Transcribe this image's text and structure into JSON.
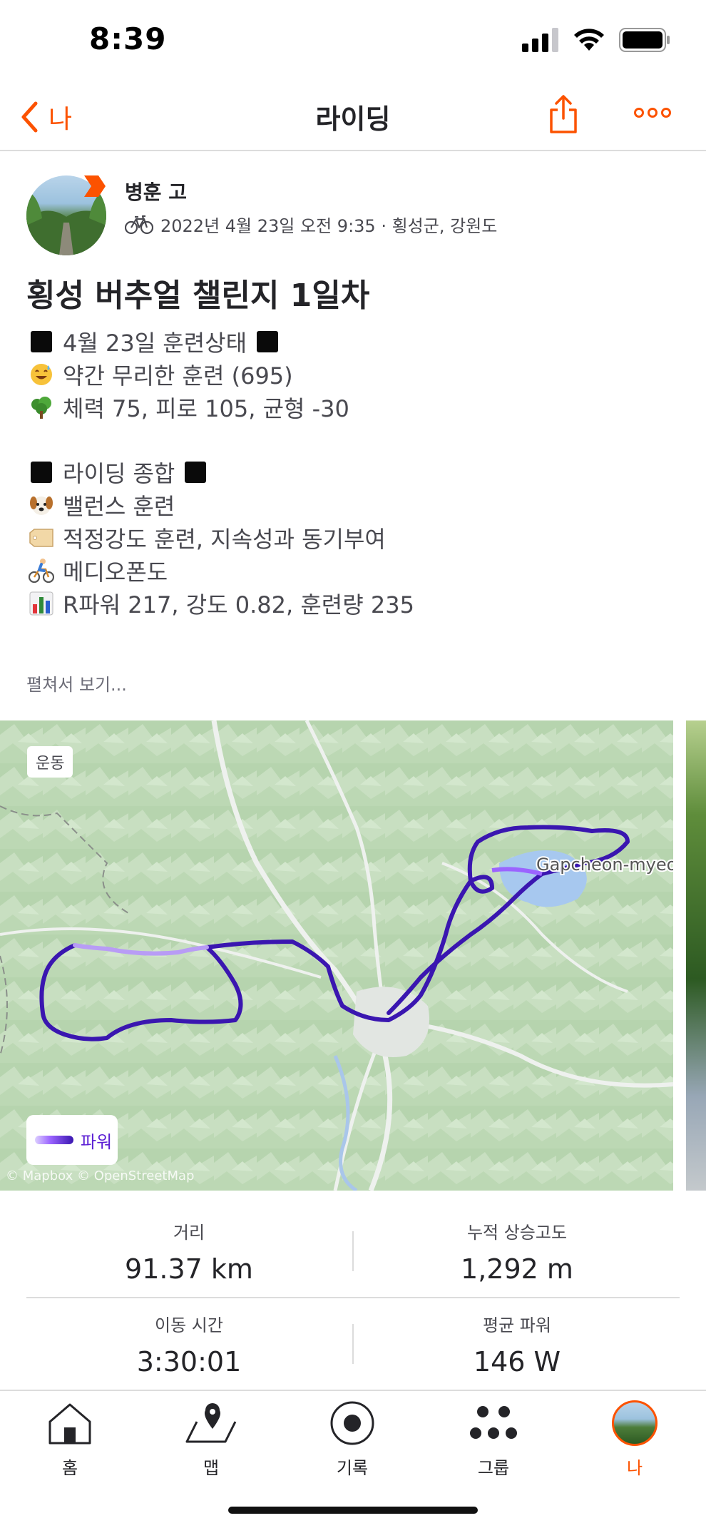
{
  "status_bar": {
    "time": "8:39"
  },
  "nav": {
    "back_label": "나",
    "title": "라이딩"
  },
  "athlete": {
    "name": "병훈 고",
    "meta": "2022년 4월 23일 오전 9:35 · 횡성군, 강원도"
  },
  "activity": {
    "title": "횡성 버추얼 챌린지 1일차",
    "description": [
      {
        "icon": "black-square",
        "text": "4월 23일 훈련상태",
        "trailing_square": true
      },
      {
        "icon": "sweat-smile-emoji",
        "text": "약간 무리한 훈련 (695)"
      },
      {
        "icon": "tree-emoji",
        "text": "체력 75, 피로 105, 균형 -30"
      },
      {
        "icon": "black-square",
        "text": "라이딩 종합",
        "trailing_square": true
      },
      {
        "icon": "dog-emoji",
        "text": "밸런스 훈련"
      },
      {
        "icon": "tag-emoji",
        "text": "적정강도 훈련, 지속성과 동기부여"
      },
      {
        "icon": "cyclist-emoji",
        "text": "메디오폰도"
      },
      {
        "icon": "bar-chart-emoji",
        "text": "R파워 217, 강도 0.82, 훈련량 235"
      }
    ],
    "more_link": "펼쳐서 보기..."
  },
  "map": {
    "chip": "운동",
    "place_label": "Gapcheon-myeon",
    "legend_label": "파워",
    "attribution": "© Mapbox © OpenStreetMap"
  },
  "stats": {
    "distance": {
      "label": "거리",
      "value": "91.37 km"
    },
    "elevation": {
      "label": "누적 상승고도",
      "value": "1,292 m"
    },
    "moving_time": {
      "label": "이동 시간",
      "value": "3:30:01"
    },
    "avg_power": {
      "label": "평균 파워",
      "value": "146 W"
    }
  },
  "tabbar": {
    "home": "홈",
    "maps": "맵",
    "record": "기록",
    "groups": "그룹",
    "you": "나"
  },
  "colors": {
    "brand": "#fc5200",
    "power_route": "#4a1fc2"
  }
}
